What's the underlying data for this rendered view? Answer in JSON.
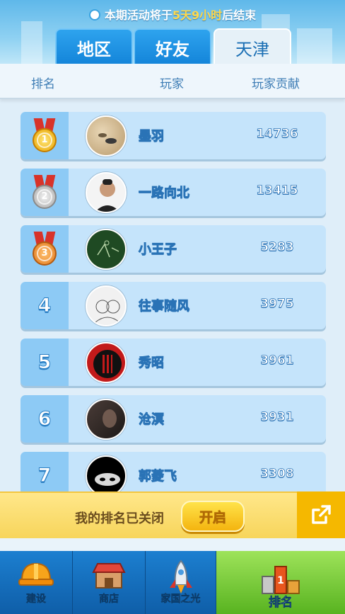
{
  "notice": {
    "prefix": "本期活动将于",
    "highlight": "5天9小时",
    "suffix": "后结束"
  },
  "tabs": [
    {
      "label": "地区"
    },
    {
      "label": "好友"
    },
    {
      "label": "天津"
    }
  ],
  "columns": {
    "rank": "排名",
    "player": "玩家",
    "contribution": "玩家贡献"
  },
  "rows": [
    {
      "rank": "1",
      "medal": "gold",
      "name": "墨羽",
      "score": "14736"
    },
    {
      "rank": "2",
      "medal": "silver",
      "name": "一路向北",
      "score": "13415"
    },
    {
      "rank": "3",
      "medal": "bronze",
      "name": "小王子",
      "score": "5283"
    },
    {
      "rank": "4",
      "name": "往事随风",
      "score": "3975"
    },
    {
      "rank": "5",
      "name": "秀昭",
      "score": "3961"
    },
    {
      "rank": "6",
      "name": "沧溟",
      "score": "3931"
    },
    {
      "rank": "7",
      "name": "郭菱飞",
      "score": "3308"
    }
  ],
  "banner": {
    "text": "我的排名已关闭",
    "button": "开启",
    "share_icon": "share-icon"
  },
  "nav": [
    {
      "label": "建设",
      "icon": "hardhat-icon"
    },
    {
      "label": "商店",
      "icon": "shop-icon"
    },
    {
      "label": "家国之光",
      "icon": "rocket-icon"
    },
    {
      "label": "排名",
      "icon": "ranking-icon"
    }
  ],
  "colors": {
    "accent": "#1b84d8",
    "banner": "#f7d55b",
    "active_nav": "#6cc42c"
  }
}
